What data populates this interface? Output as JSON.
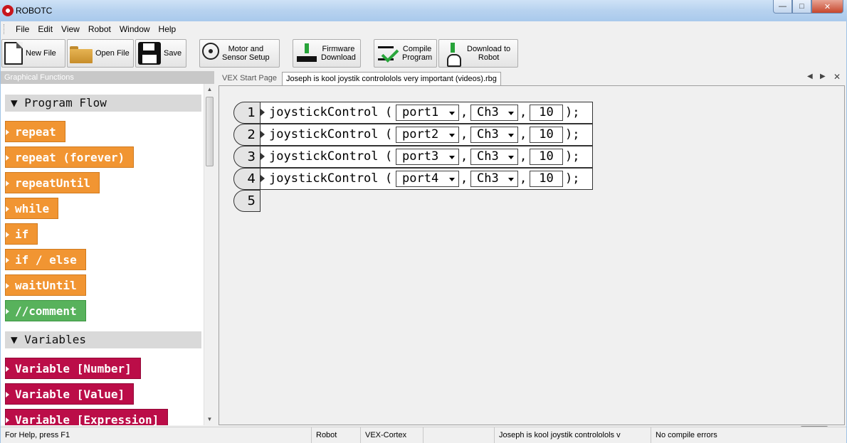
{
  "window": {
    "title": "ROBOTC",
    "minimize": "—",
    "maximize": "□",
    "close": "✕"
  },
  "menu": [
    "File",
    "Edit",
    "View",
    "Robot",
    "Window",
    "Help"
  ],
  "toolbar": {
    "new_file": "New File",
    "open_file": "Open File",
    "save": "Save",
    "motor_l1": "Motor and",
    "motor_l2": "Sensor Setup",
    "firmware_l1": "Firmware",
    "firmware_l2": "Download",
    "compile_l1": "Compile",
    "compile_l2": "Program",
    "download_l1": "Download to",
    "download_l2": "Robot"
  },
  "panel": {
    "header": "Graphical Functions",
    "sections": {
      "program_flow": "▼ Program Flow",
      "variables": "▼ Variables"
    },
    "program_flow": [
      "repeat",
      "repeat (forever)",
      "repeatUntil",
      "while",
      "if",
      "if / else",
      "waitUntil",
      "//comment"
    ],
    "variables": [
      "Variable [Number]",
      "Variable [Value]",
      "Variable [Expression]"
    ]
  },
  "tabs": {
    "start_page": "VEX Start Page",
    "active": "Joseph is kool  joystik contrololols very important (videos).rbg"
  },
  "code": {
    "line_numbers": [
      "1",
      "2",
      "3",
      "4",
      "5"
    ],
    "func": "joystickControl",
    "open_paren": "(",
    "comma": ",",
    "close": ");",
    "rows": [
      {
        "port": "port1",
        "channel": "Ch3",
        "value": "10"
      },
      {
        "port": "port2",
        "channel": "Ch3",
        "value": "10"
      },
      {
        "port": "port3",
        "channel": "Ch3",
        "value": "10"
      },
      {
        "port": "port4",
        "channel": "Ch3",
        "value": "10"
      }
    ]
  },
  "status": {
    "help": "For Help, press F1",
    "mode": "Robot",
    "platform": "VEX-Cortex",
    "file": "Joseph is kool  joystik contrololols v",
    "compile": "No compile errors"
  },
  "colors": {
    "flow_block": "#f19532",
    "comment_block": "#58b25c",
    "variable_block": "#bb0d48"
  },
  "icons": [
    "robotc-app-icon",
    "new-file-icon",
    "open-folder-icon",
    "save-disk-icon",
    "motor-sensor-icon",
    "firmware-chip-icon",
    "compile-check-icon",
    "download-robot-icon",
    "trash-recycle-icon"
  ]
}
